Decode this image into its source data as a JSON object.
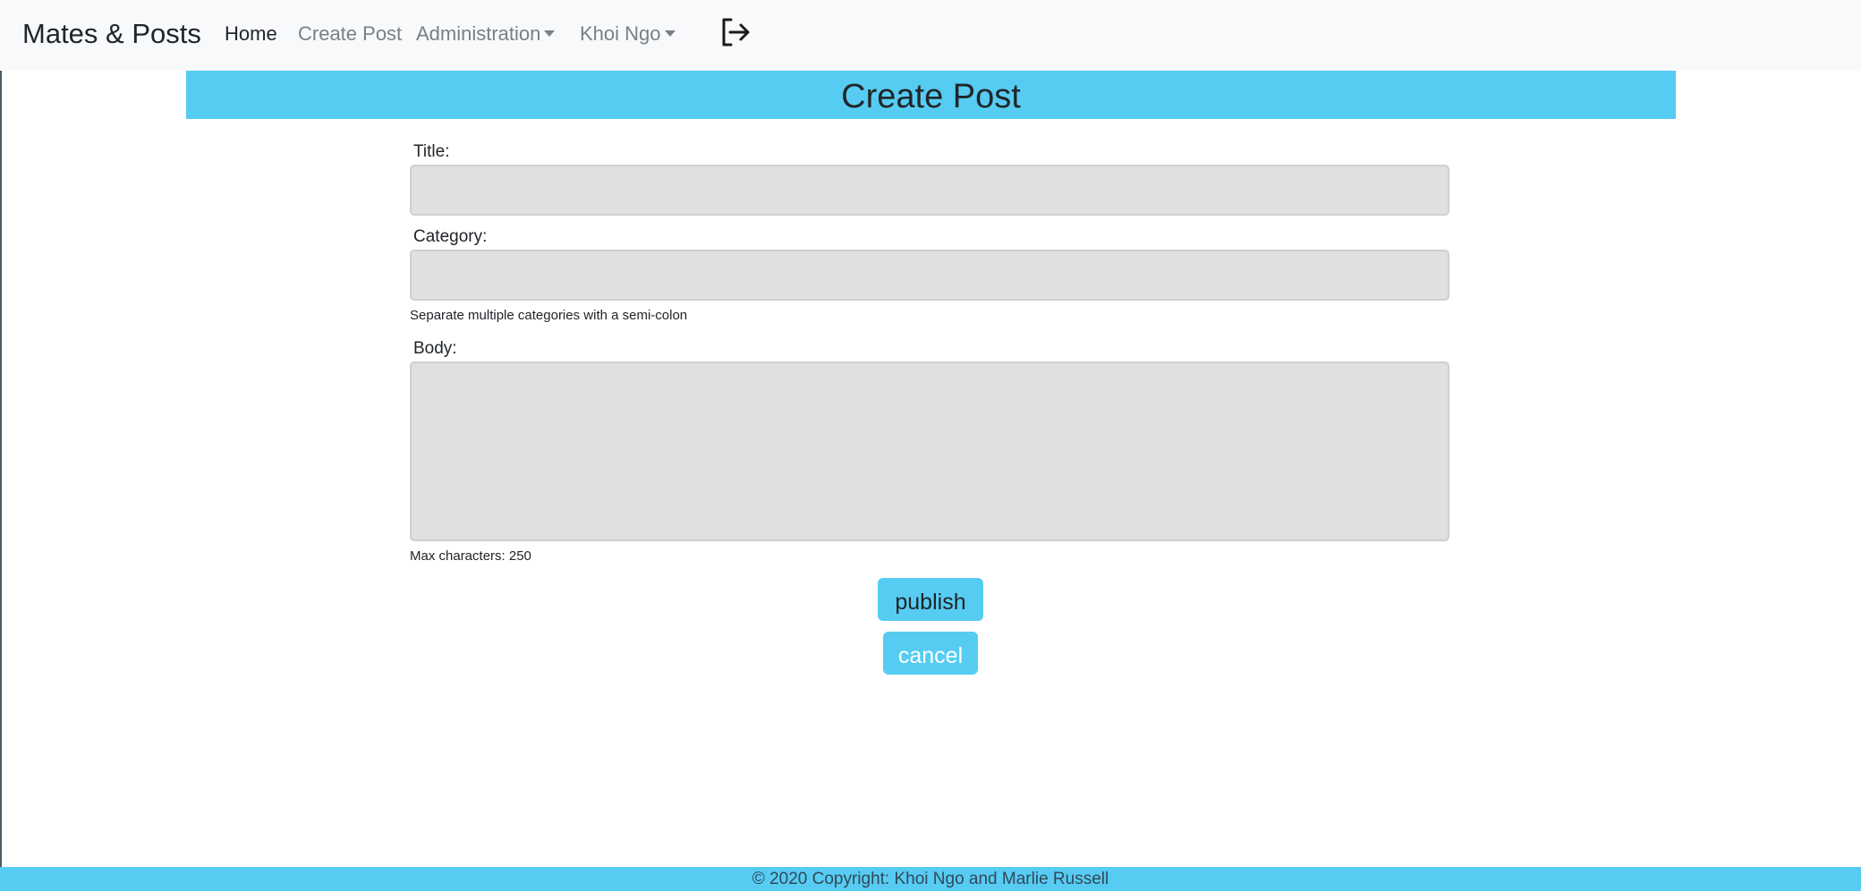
{
  "navbar": {
    "brand": "Mates & Posts",
    "links": {
      "home": "Home",
      "create_post": "Create Post",
      "administration": "Administration",
      "user": "Khoi Ngo"
    },
    "logout_icon": "logout-icon"
  },
  "header": {
    "title": "Create Post"
  },
  "form": {
    "title_label": "Title:",
    "title_value": "",
    "category_label": "Category:",
    "category_value": "",
    "category_hint": "Separate multiple categories with a semi-colon",
    "body_label": "Body:",
    "body_value": "",
    "body_hint": "Max characters: 250",
    "publish_label": "publish",
    "cancel_label": "cancel"
  },
  "footer": {
    "text": "© 2020 Copyright: Khoi Ngo and Marlie Russell"
  },
  "colors": {
    "accent": "#56ccf2",
    "field_bg": "#e0e0e0",
    "navbar_bg": "#f8f9fa"
  }
}
